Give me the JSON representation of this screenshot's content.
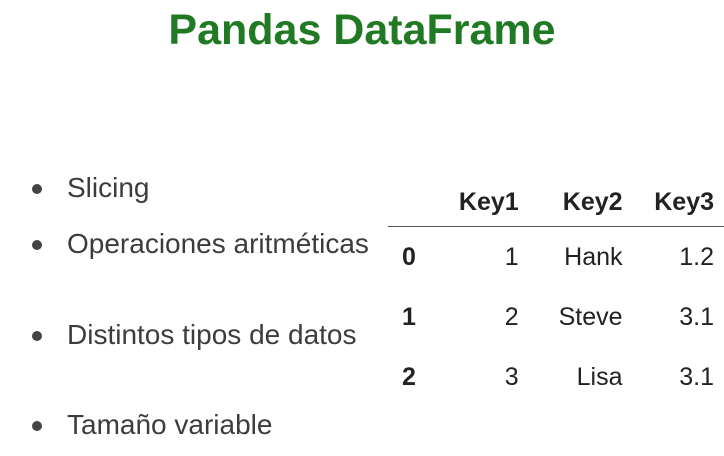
{
  "title": "Pandas DataFrame",
  "bullets": [
    "Slicing",
    "Operaciones aritméticas",
    "Distintos tipos de datos",
    "Tamaño variable"
  ],
  "table": {
    "headers": [
      "",
      "Key1",
      "Key2",
      "Key3"
    ],
    "rows": [
      {
        "index": "0",
        "key1": "1",
        "key2": "Hank",
        "key3": "1.2"
      },
      {
        "index": "1",
        "key1": "2",
        "key2": "Steve",
        "key3": "3.1"
      },
      {
        "index": "2",
        "key1": "3",
        "key2": "Lisa",
        "key3": "3.1"
      }
    ]
  },
  "colors": {
    "title": "#1f7a23",
    "text": "#3c3c3c"
  }
}
